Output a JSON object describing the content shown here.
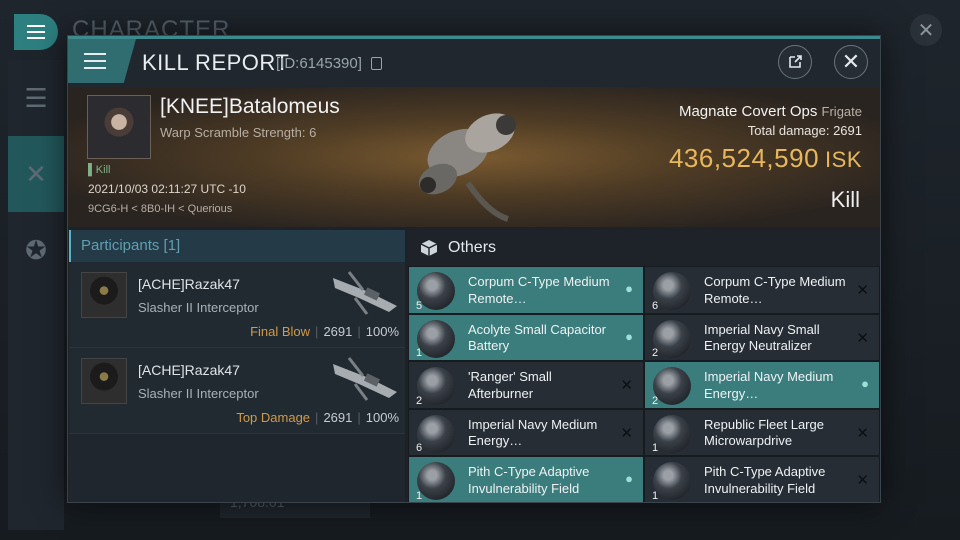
{
  "background": {
    "title": "CHARACTER",
    "footer_value": "1,708.01"
  },
  "header": {
    "title": "KILL REPORT",
    "id": "[ID:6145390]"
  },
  "victim": {
    "name": "[KNEE]Batalomeus",
    "warp_scramble": "Warp Scramble Strength: 6",
    "kill_tag": "Kill",
    "time": "2021/10/03 02:11:27 UTC -10",
    "location": "9CG6-H < 8B0-IH < Querious",
    "ship": "Magnate Covert Ops",
    "ship_class": "Frigate",
    "total_damage_label": "Total damage:",
    "total_damage": "2691",
    "isk_value": "436,524,590",
    "isk_unit": "ISK",
    "result": "Kill"
  },
  "participants": {
    "label": "Participants",
    "count": "[1]",
    "rows": [
      {
        "name": "[ACHE]Razak47",
        "ship": "Slasher II Interceptor",
        "tag": "Final Blow",
        "damage": "2691",
        "percent": "100%"
      },
      {
        "name": "[ACHE]Razak47",
        "ship": "Slasher II Interceptor",
        "tag": "Top Damage",
        "damage": "2691",
        "percent": "100%"
      }
    ]
  },
  "items": {
    "label": "Others",
    "list": [
      {
        "qty": "5",
        "name": "Corpum C-Type Medium Remote…",
        "dropped": true
      },
      {
        "qty": "6",
        "name": "Corpum C-Type Medium Remote…",
        "dropped": false
      },
      {
        "qty": "1",
        "name": "Acolyte Small Capacitor Battery",
        "dropped": true
      },
      {
        "qty": "2",
        "name": "Imperial Navy Small Energy Neutralizer",
        "dropped": false
      },
      {
        "qty": "2",
        "name": "'Ranger' Small Afterburner",
        "dropped": false
      },
      {
        "qty": "2",
        "name": "Imperial Navy Medium Energy…",
        "dropped": true
      },
      {
        "qty": "6",
        "name": "Imperial Navy Medium Energy…",
        "dropped": false
      },
      {
        "qty": "1",
        "name": "Republic Fleet Large Microwarpdrive",
        "dropped": false
      },
      {
        "qty": "1",
        "name": "Pith C-Type Adaptive Invulnerability Field",
        "dropped": true
      },
      {
        "qty": "1",
        "name": "Pith C-Type Adaptive Invulnerability Field",
        "dropped": false
      }
    ]
  }
}
